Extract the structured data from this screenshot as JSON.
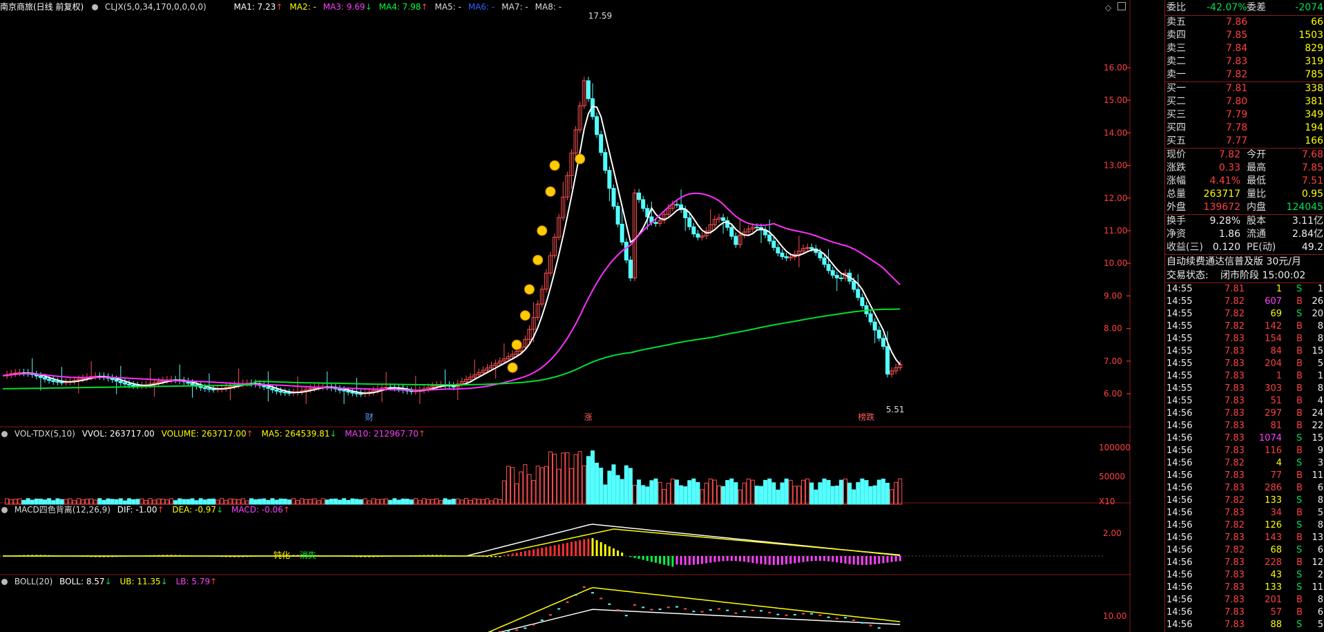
{
  "chart_header": {
    "stock_name": "南京商旅(日线 前复权)",
    "indicator": "CLJX(5,0,34,170,0,0,0,0)",
    "ma": [
      {
        "label": "MA1: 7.23",
        "arrow": "↑",
        "color": "#ffffff"
      },
      {
        "label": "MA2: -",
        "arrow": "",
        "color": "#ffff00"
      },
      {
        "label": "MA3: 9.69",
        "arrow": "↓",
        "color": "#ff40ff"
      },
      {
        "label": "MA4: 7.98",
        "arrow": "↑",
        "color": "#00ff40"
      },
      {
        "label": "MA5: -",
        "arrow": "",
        "color": "#dddddd"
      },
      {
        "label": "MA6: -",
        "arrow": "",
        "color": "#3060ff"
      },
      {
        "label": "MA7: -",
        "arrow": "",
        "color": "#dddddd"
      },
      {
        "label": "MA8: -",
        "arrow": "",
        "color": "#dddddd"
      }
    ]
  },
  "price_axis": [
    "16.00",
    "15.00",
    "14.00",
    "13.00",
    "12.00",
    "11.00",
    "10.00",
    "9.00",
    "8.00",
    "7.00",
    "6.00"
  ],
  "price_annotations": {
    "high": "17.59",
    "low": "5.51",
    "markers": [
      "财",
      "涨",
      "榜跌"
    ]
  },
  "volume_header": {
    "name": "VOL-TDX(5,10)",
    "vvol": "VVOL: 263717.00",
    "volume": "VOLUME: 263717.00",
    "ma5": "MA5: 264539.81",
    "ma10": "MA10: 212967.70"
  },
  "volume_axis": [
    "100000",
    "50000",
    "X10"
  ],
  "macd_header": {
    "name": "MACD四色背离(12,26,9)",
    "dif": "DIF: -1.00",
    "dea": "DEA: -0.97",
    "macd": "MACD: -0.06"
  },
  "macd_axis": [
    "2.00"
  ],
  "macd_labels": [
    "钝化",
    "消失"
  ],
  "boll_header": {
    "name": "BOLL(20)",
    "boll": "BOLL: 8.57",
    "ub": "UB: 11.35",
    "lb": "LB: 5.79"
  },
  "boll_axis": [
    "10.00"
  ],
  "side": {
    "weibi": {
      "label": "委比",
      "value": "-42.07%",
      "label2": "委差",
      "value2": "-2074"
    },
    "asks": [
      {
        "label": "卖五",
        "price": "7.86",
        "vol": "66"
      },
      {
        "label": "卖四",
        "price": "7.85",
        "vol": "1503"
      },
      {
        "label": "卖三",
        "price": "7.84",
        "vol": "829"
      },
      {
        "label": "卖二",
        "price": "7.83",
        "vol": "319"
      },
      {
        "label": "卖一",
        "price": "7.82",
        "vol": "785"
      }
    ],
    "bids": [
      {
        "label": "买一",
        "price": "7.81",
        "vol": "338"
      },
      {
        "label": "买二",
        "price": "7.80",
        "vol": "381"
      },
      {
        "label": "买三",
        "price": "7.79",
        "vol": "349"
      },
      {
        "label": "买四",
        "price": "7.78",
        "vol": "194"
      },
      {
        "label": "买五",
        "price": "7.77",
        "vol": "166"
      }
    ],
    "quote": [
      {
        "l1": "现价",
        "v1": "7.82",
        "c1": "red",
        "l2": "今开",
        "v2": "7.68",
        "c2": "red"
      },
      {
        "l1": "涨跌",
        "v1": "0.33",
        "c1": "red",
        "l2": "最高",
        "v2": "7.85",
        "c2": "red"
      },
      {
        "l1": "涨幅",
        "v1": "4.41%",
        "c1": "red",
        "l2": "最低",
        "v2": "7.51",
        "c2": "red"
      },
      {
        "l1": "总量",
        "v1": "263717",
        "c1": "yellow",
        "l2": "量比",
        "v2": "0.95",
        "c2": "yellow"
      },
      {
        "l1": "外盘",
        "v1": "139672",
        "c1": "red",
        "l2": "内盘",
        "v2": "124045",
        "c2": "green"
      }
    ],
    "fundamentals": [
      {
        "l1": "换手",
        "v1": "9.28%",
        "l2": "股本",
        "v2": "3.11亿"
      },
      {
        "l1": "净资",
        "v1": "1.86",
        "l2": "流通",
        "v2": "2.84亿"
      },
      {
        "l1": "收益(三)",
        "v1": "0.120",
        "l2": "PE(动)",
        "v2": "49.2"
      }
    ],
    "promo": "自动续费通达信普及版  30元/月",
    "status_label": "交易状态:",
    "status_value": "闭市阶段 15:00:02",
    "ticks": [
      {
        "t": "14:55",
        "p": "7.81",
        "v": "1",
        "bs": "S",
        "n": "1"
      },
      {
        "t": "14:55",
        "p": "7.82",
        "v": "607",
        "bs": "B",
        "n": "26"
      },
      {
        "t": "14:55",
        "p": "7.82",
        "v": "69",
        "bs": "S",
        "n": "20"
      },
      {
        "t": "14:55",
        "p": "7.82",
        "v": "142",
        "bs": "B",
        "n": "8"
      },
      {
        "t": "14:55",
        "p": "7.83",
        "v": "154",
        "bs": "B",
        "n": "8"
      },
      {
        "t": "14:55",
        "p": "7.83",
        "v": "84",
        "bs": "B",
        "n": "15"
      },
      {
        "t": "14:55",
        "p": "7.83",
        "v": "204",
        "bs": "B",
        "n": "5"
      },
      {
        "t": "14:55",
        "p": "7.83",
        "v": "1",
        "bs": "B",
        "n": "1"
      },
      {
        "t": "14:55",
        "p": "7.83",
        "v": "303",
        "bs": "B",
        "n": "8"
      },
      {
        "t": "14:55",
        "p": "7.83",
        "v": "51",
        "bs": "B",
        "n": "4"
      },
      {
        "t": "14:56",
        "p": "7.83",
        "v": "297",
        "bs": "B",
        "n": "24"
      },
      {
        "t": "14:56",
        "p": "7.83",
        "v": "81",
        "bs": "B",
        "n": "22"
      },
      {
        "t": "14:56",
        "p": "7.83",
        "v": "1074",
        "bs": "S",
        "n": "15"
      },
      {
        "t": "14:56",
        "p": "7.83",
        "v": "116",
        "bs": "B",
        "n": "9"
      },
      {
        "t": "14:56",
        "p": "7.82",
        "v": "4",
        "bs": "S",
        "n": "3"
      },
      {
        "t": "14:56",
        "p": "7.83",
        "v": "77",
        "bs": "B",
        "n": "11"
      },
      {
        "t": "14:56",
        "p": "7.83",
        "v": "286",
        "bs": "B",
        "n": "6"
      },
      {
        "t": "14:56",
        "p": "7.82",
        "v": "133",
        "bs": "S",
        "n": "8"
      },
      {
        "t": "14:56",
        "p": "7.83",
        "v": "34",
        "bs": "B",
        "n": "5"
      },
      {
        "t": "14:56",
        "p": "7.82",
        "v": "126",
        "bs": "S",
        "n": "8"
      },
      {
        "t": "14:56",
        "p": "7.83",
        "v": "143",
        "bs": "B",
        "n": "13"
      },
      {
        "t": "14:56",
        "p": "7.82",
        "v": "68",
        "bs": "S",
        "n": "6"
      },
      {
        "t": "14:56",
        "p": "7.83",
        "v": "228",
        "bs": "B",
        "n": "12"
      },
      {
        "t": "14:56",
        "p": "7.83",
        "v": "43",
        "bs": "S",
        "n": "2"
      },
      {
        "t": "14:56",
        "p": "7.83",
        "v": "133",
        "bs": "S",
        "n": "11"
      },
      {
        "t": "14:56",
        "p": "7.83",
        "v": "201",
        "bs": "B",
        "n": "8"
      },
      {
        "t": "14:56",
        "p": "7.83",
        "v": "57",
        "bs": "B",
        "n": "6"
      },
      {
        "t": "14:56",
        "p": "7.83",
        "v": "88",
        "bs": "S",
        "n": "5"
      }
    ]
  },
  "colors": {
    "up": "#ff5050",
    "down": "#54ffff",
    "border": "#8b1a1a",
    "ma1": "#ffffff",
    "ma3": "#ff30ff",
    "ma4": "#00e030"
  }
}
